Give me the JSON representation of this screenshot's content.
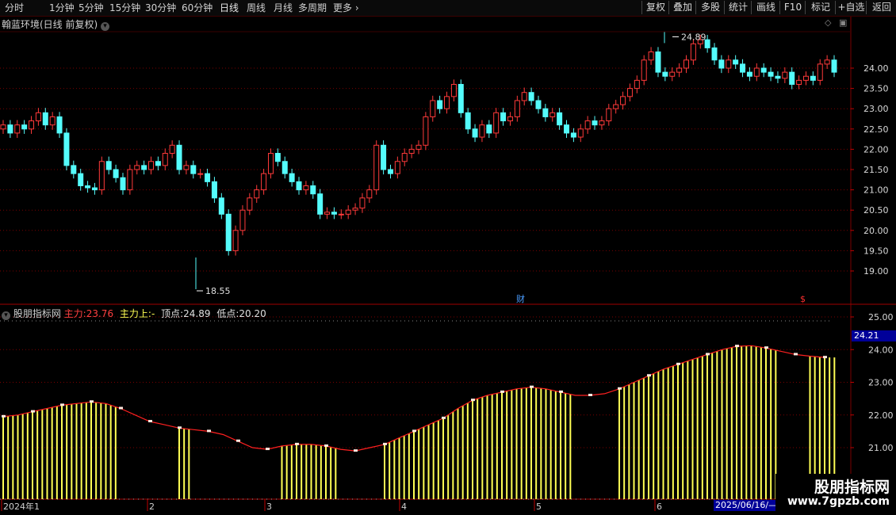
{
  "toolbar": {
    "periods": [
      "分时",
      "1分钟",
      "5分钟",
      "15分钟",
      "30分钟",
      "60分钟",
      "日线",
      "周线",
      "月线",
      "多周期",
      "更多"
    ],
    "active_period": "日线",
    "right_buttons": [
      "复权",
      "叠加",
      "多股",
      "统计",
      "画线",
      "F10",
      "标记",
      "+自选",
      "返回"
    ]
  },
  "price_panel": {
    "title": "翰蓝环境(日线 前复权)",
    "y_ticks": [
      "24.00",
      "23.50",
      "23.00",
      "22.50",
      "22.00",
      "21.50",
      "21.00",
      "20.50",
      "20.00",
      "19.50",
      "19.00"
    ],
    "high_label": "24.89",
    "low_label": "18.55",
    "marker_cai": "财",
    "marker_dollar": "$"
  },
  "indicator_panel": {
    "name": "股朋指标网",
    "main_label": "主力:",
    "main_value": "23.76",
    "main_up_label": "主力上:",
    "main_up_value": "-",
    "top_label": "顶点:",
    "top_value": "24.89",
    "low_label": "低点:",
    "low_value": "20.20",
    "y_ticks": [
      "25.00",
      "24.00",
      "23.00",
      "22.00",
      "21.00"
    ],
    "current_value": "24.21"
  },
  "x_axis": {
    "labels": [
      "2024年1",
      "2",
      "3",
      "4",
      "5",
      "6"
    ],
    "cursor_date": "2025/06/16/—"
  },
  "watermark": {
    "name": "股朋指标网",
    "url": "www.7gpzb.com"
  },
  "colors": {
    "up": "#ff3a3a",
    "down": "#54fcfc",
    "bar": "#ffff54",
    "line": "#ff2020",
    "grid": "#7a0000"
  },
  "chart_data": {
    "type": "candlestick",
    "y_range": [
      18.5,
      25.0
    ],
    "high": 24.89,
    "low": 18.55,
    "closes": [
      22.6,
      22.4,
      22.6,
      22.5,
      22.7,
      22.9,
      22.6,
      22.8,
      22.4,
      21.6,
      21.4,
      21.1,
      21.05,
      21.0,
      21.7,
      21.5,
      21.3,
      21.0,
      21.5,
      21.6,
      21.5,
      21.7,
      21.6,
      21.9,
      22.1,
      21.5,
      21.6,
      21.4,
      21.4,
      21.2,
      20.8,
      20.4,
      19.5,
      20.0,
      20.5,
      20.8,
      21.0,
      21.4,
      21.9,
      21.7,
      21.4,
      21.2,
      21.0,
      21.1,
      20.9,
      20.4,
      20.45,
      20.4,
      20.4,
      20.5,
      20.55,
      20.8,
      21.0,
      22.1,
      21.5,
      21.4,
      21.7,
      21.9,
      22.0,
      22.1,
      22.8,
      23.2,
      23.0,
      23.3,
      23.6,
      22.9,
      22.5,
      22.3,
      22.6,
      22.4,
      22.9,
      22.7,
      22.8,
      23.2,
      23.4,
      23.2,
      23.0,
      22.8,
      22.9,
      22.6,
      22.4,
      22.3,
      22.5,
      22.7,
      22.6,
      22.7,
      23.0,
      23.1,
      23.3,
      23.5,
      23.7,
      24.2,
      24.4,
      23.9,
      23.8,
      23.9,
      24.0,
      24.2,
      24.6,
      24.7,
      24.5,
      24.2,
      24.0,
      24.2,
      24.1,
      23.9,
      23.8,
      24.0,
      23.9,
      23.8,
      23.75,
      23.9,
      23.6,
      23.7,
      23.8,
      23.7,
      24.1,
      24.2,
      23.9
    ],
    "indicator": {
      "main_line": [
        21.95,
        22.0,
        22.1,
        22.2,
        22.3,
        22.35,
        22.4,
        22.35,
        22.2,
        22.0,
        21.8,
        21.7,
        21.6,
        21.55,
        21.5,
        21.4,
        21.2,
        21.0,
        20.95,
        21.05,
        21.1,
        21.1,
        21.05,
        20.95,
        20.9,
        21.0,
        21.1,
        21.3,
        21.5,
        21.7,
        21.9,
        22.2,
        22.45,
        22.6,
        22.7,
        22.8,
        22.85,
        22.8,
        22.7,
        22.6,
        22.6,
        22.65,
        22.8,
        23.0,
        23.2,
        23.4,
        23.55,
        23.7,
        23.85,
        24.0,
        24.1,
        24.12,
        24.05,
        23.95,
        23.85,
        23.8,
        23.76
      ],
      "active_from_index": [
        0,
        1,
        2,
        3,
        4,
        5,
        6,
        7,
        12,
        19,
        20,
        21,
        22,
        26,
        27,
        28,
        29,
        30,
        31,
        32,
        33,
        34,
        35,
        36,
        37,
        38,
        42,
        43,
        44,
        45,
        46,
        47,
        48,
        49,
        50,
        51,
        52,
        55,
        56
      ],
      "baseline": 20.2
    }
  }
}
